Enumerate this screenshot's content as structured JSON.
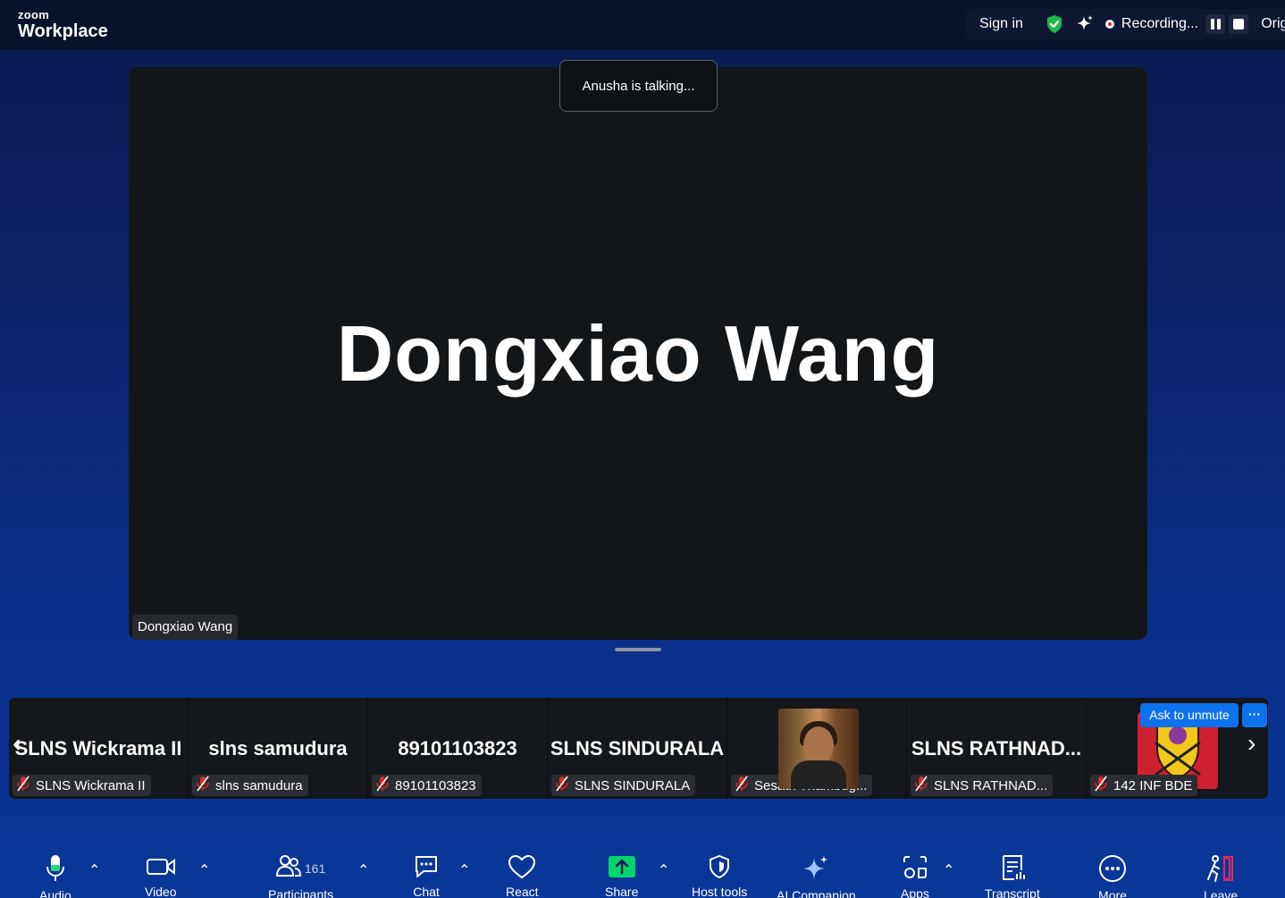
{
  "app": {
    "brand_small": "zoom",
    "brand_large": "Workplace"
  },
  "topbar": {
    "sign_in": "Sign in",
    "recording_label": "Recording...",
    "truncated_label": "Orig"
  },
  "talking_indicator": "Anusha is talking...",
  "main_video": {
    "display_name": "Dongxiao Wang",
    "name_tag": "Dongxiao Wang"
  },
  "gallery": {
    "tiles": [
      {
        "big": "SLNS Wickrama II",
        "label": "SLNS Wickrama II"
      },
      {
        "big": "slns samudura",
        "label": "slns samudura"
      },
      {
        "big": "89101103823",
        "label": "89101103823"
      },
      {
        "big": "SLNS SINDURALA",
        "label": "SLNS SINDURALA"
      },
      {
        "big": "",
        "label": "Sesath Thambug..."
      },
      {
        "big": "SLNS  RATHNAD...",
        "label": "SLNS RATHNAD..."
      },
      {
        "big": "",
        "label": "142 INF BDE"
      }
    ],
    "ask_to_unmute": "Ask to unmute",
    "more": "···"
  },
  "toolbar": {
    "audio": "Audio",
    "video": "Video",
    "participants": "Participants",
    "participants_count": "161",
    "chat": "Chat",
    "react": "React",
    "share": "Share",
    "host_tools": "Host tools",
    "ai_companion": "AI Companion",
    "apps": "Apps",
    "transcript": "Transcript",
    "more": "More",
    "leave": "Leave"
  },
  "colors": {
    "accent_blue": "#0e72ed",
    "share_green": "#00d66b",
    "shield_green": "#1fb94b",
    "leave_red": "#e02a5f",
    "muted_red": "#e02828"
  }
}
